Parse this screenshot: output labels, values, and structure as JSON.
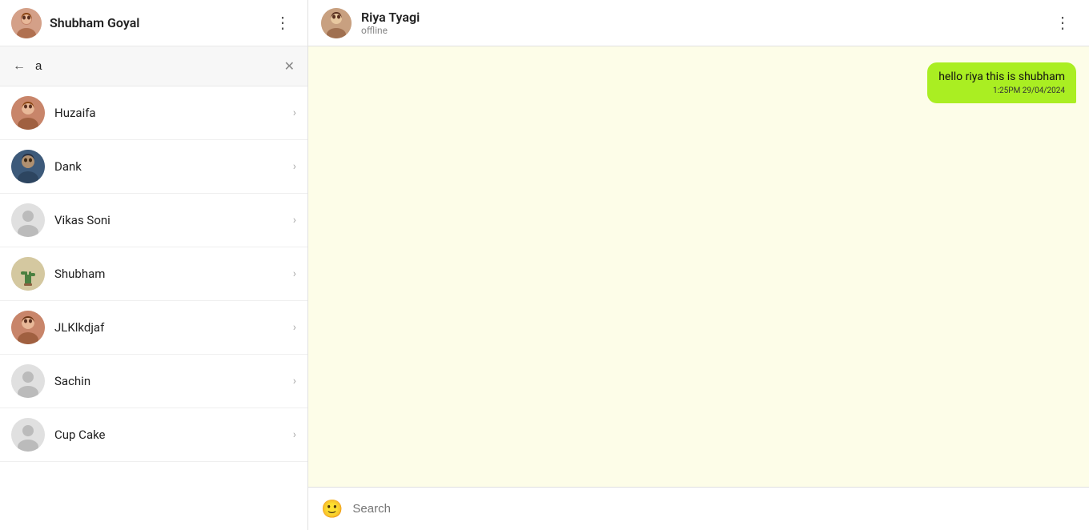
{
  "sidebar": {
    "header": {
      "user_name": "Shubham Goyal",
      "dots_label": "⋮"
    },
    "search": {
      "value": "a",
      "placeholder": "",
      "back_icon": "←",
      "clear_icon": "✕"
    },
    "contacts": [
      {
        "id": "huzaifa",
        "name": "Huzaifa",
        "avatar_type": "person_brown",
        "chevron": "›"
      },
      {
        "id": "dank",
        "name": "Dank",
        "avatar_type": "person_dark",
        "chevron": "›"
      },
      {
        "id": "vikas_soni",
        "name": "Vikas Soni",
        "avatar_type": "generic",
        "chevron": "›"
      },
      {
        "id": "shubham",
        "name": "Shubham",
        "avatar_type": "plant",
        "chevron": "›"
      },
      {
        "id": "jlklkdjaf",
        "name": "JLKlkdjaf",
        "avatar_type": "person_brown2",
        "chevron": "›"
      },
      {
        "id": "sachin",
        "name": "Sachin",
        "avatar_type": "generic",
        "chevron": "›"
      },
      {
        "id": "cupcake",
        "name": "Cup Cake",
        "avatar_type": "generic",
        "chevron": "›"
      }
    ]
  },
  "chat": {
    "header": {
      "name": "Riya Tyagi",
      "status": "offline",
      "dots_label": "⋮"
    },
    "messages": [
      {
        "id": "msg1",
        "text": "hello riya this is shubham",
        "time": "1:25PM 29/04/2024",
        "direction": "outgoing"
      }
    ],
    "input": {
      "placeholder": "Search",
      "emoji_icon": "🙂"
    }
  },
  "colors": {
    "message_bg": "#aaee22",
    "chat_bg": "#fdfde8",
    "accent": "#aaee22"
  }
}
